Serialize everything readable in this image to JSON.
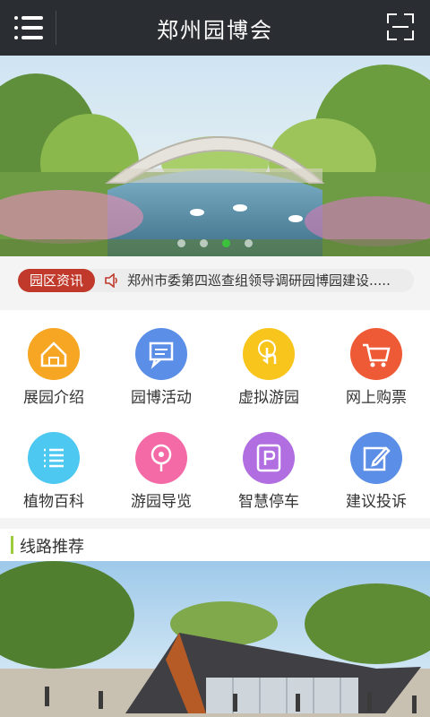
{
  "header": {
    "title": "郑州园博会",
    "menu_icon": "menu-icon",
    "scan_icon": "scan-icon"
  },
  "banner": {
    "dots": 4,
    "active_index": 2
  },
  "news": {
    "tag": "园区资讯",
    "text": "郑州市委第四巡查组领导调研园博园建设.....",
    "icon": "speaker-icon"
  },
  "grid": [
    {
      "label": "展园介绍",
      "icon": "house-icon",
      "color": "#f6a623"
    },
    {
      "label": "园博活动",
      "icon": "chat-icon",
      "color": "#5b8ee6"
    },
    {
      "label": "虚拟游园",
      "icon": "touch-icon",
      "color": "#f8c51c"
    },
    {
      "label": "网上购票",
      "icon": "cart-icon",
      "color": "#ef5a36"
    },
    {
      "label": "植物百科",
      "icon": "list-icon",
      "color": "#4dc8f0"
    },
    {
      "label": "游园导览",
      "icon": "location-icon",
      "color": "#f36aa6"
    },
    {
      "label": "智慧停车",
      "icon": "parking-icon",
      "color": "#b06ee0"
    },
    {
      "label": "建议投诉",
      "icon": "edit-icon",
      "color": "#5b8ee6"
    }
  ],
  "section": {
    "title": "线路推荐"
  },
  "colors": {
    "topbar": "#2a2d31",
    "tag": "#c0392b",
    "dot_active": "#3cc13c",
    "section_accent": "#9ccc3c"
  }
}
